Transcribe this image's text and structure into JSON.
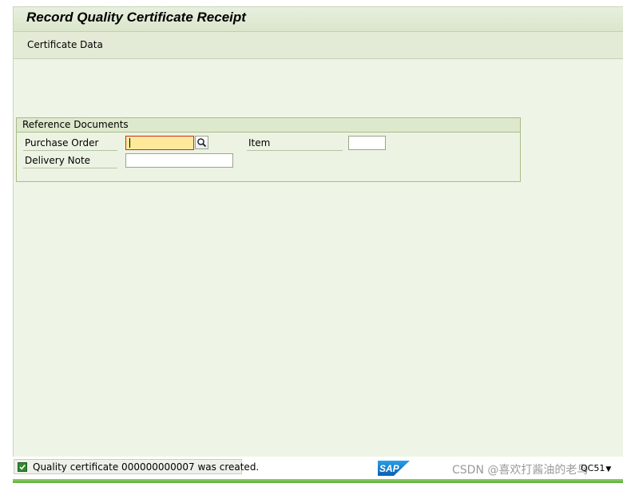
{
  "window": {
    "title": "Record Quality Certificate Receipt"
  },
  "app_toolbar": {
    "certificate_data": "Certificate Data"
  },
  "reference_documents": {
    "group_title": "Reference Documents",
    "purchase_order": {
      "label": "Purchase Order",
      "value": ""
    },
    "item": {
      "label": "Item",
      "value": ""
    },
    "delivery_note": {
      "label": "Delivery Note",
      "value": ""
    }
  },
  "status_bar": {
    "message": "Quality certificate 000000000007 was created.",
    "message_type": "success",
    "sap_logo": "SAP",
    "transaction": "QC51"
  },
  "watermark": "CSDN @喜欢打酱油的老鸟",
  "colors": {
    "background": "#eef4e6",
    "focus_field": "#fde999",
    "focus_border": "#c22d2d",
    "success": "#2f8a2f",
    "sap_blue": "#0a6ebd"
  }
}
